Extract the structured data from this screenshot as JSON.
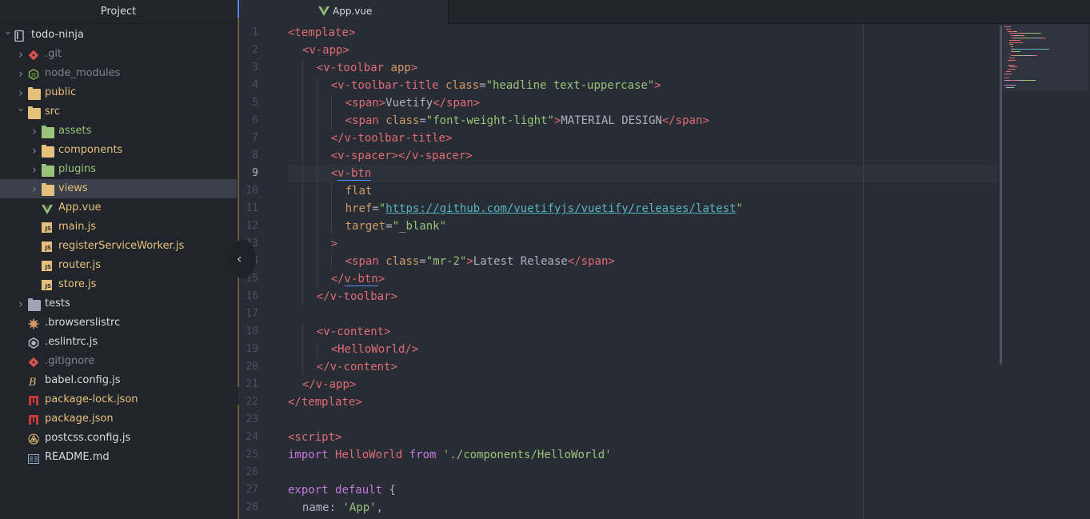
{
  "sidebar": {
    "title": "Project",
    "tree": [
      {
        "label": "todo-ninja",
        "kind": "repo",
        "depth": 0,
        "expanded": true
      },
      {
        "label": ".git",
        "kind": "git",
        "depth": 1,
        "expanded": false
      },
      {
        "label": "node_modules",
        "kind": "node",
        "depth": 1,
        "expanded": false
      },
      {
        "label": "public",
        "kind": "folder",
        "depth": 1,
        "expanded": false
      },
      {
        "label": "src",
        "kind": "folder",
        "depth": 1,
        "expanded": true
      },
      {
        "label": "assets",
        "kind": "folder-green",
        "depth": 2,
        "expanded": false
      },
      {
        "label": "components",
        "kind": "folder",
        "depth": 2,
        "expanded": false
      },
      {
        "label": "plugins",
        "kind": "folder-green",
        "depth": 2,
        "expanded": false
      },
      {
        "label": "views",
        "kind": "folder",
        "depth": 2,
        "expanded": false,
        "selected": true
      },
      {
        "label": "App.vue",
        "kind": "vue",
        "depth": 2
      },
      {
        "label": "main.js",
        "kind": "js",
        "depth": 2
      },
      {
        "label": "registerServiceWorker.js",
        "kind": "js",
        "depth": 2
      },
      {
        "label": "router.js",
        "kind": "js",
        "depth": 2
      },
      {
        "label": "store.js",
        "kind": "js",
        "depth": 2
      },
      {
        "label": "tests",
        "kind": "folder-grey",
        "depth": 1,
        "expanded": false
      },
      {
        "label": ".browserslistrc",
        "kind": "browsers",
        "depth": 1
      },
      {
        "label": ".eslintrc.js",
        "kind": "eslint",
        "depth": 1
      },
      {
        "label": ".gitignore",
        "kind": "git",
        "depth": 1
      },
      {
        "label": "babel.config.js",
        "kind": "babel",
        "depth": 1
      },
      {
        "label": "package-lock.json",
        "kind": "npm",
        "depth": 1
      },
      {
        "label": "package.json",
        "kind": "npm",
        "depth": 1
      },
      {
        "label": "postcss.config.js",
        "kind": "postcss",
        "depth": 1
      },
      {
        "label": "README.md",
        "kind": "readme",
        "depth": 1
      }
    ]
  },
  "tab": {
    "label": "App.vue"
  },
  "editor": {
    "cursor_line": 9,
    "lines": [
      {
        "n": "1",
        "indent": 0,
        "tokens": [
          [
            "tag",
            "<template>"
          ]
        ]
      },
      {
        "n": "2",
        "indent": 1,
        "tokens": [
          [
            "tag",
            "<v-app>"
          ]
        ]
      },
      {
        "n": "3",
        "indent": 2,
        "tokens": [
          [
            "tag",
            "<v-toolbar"
          ],
          [
            "p",
            " "
          ],
          [
            "attr",
            "app"
          ],
          [
            "tag",
            ">"
          ]
        ]
      },
      {
        "n": "4",
        "indent": 3,
        "tokens": [
          [
            "tag",
            "<v-toolbar-title"
          ],
          [
            "p",
            " "
          ],
          [
            "attr",
            "class"
          ],
          [
            "p",
            "="
          ],
          [
            "str",
            "\"headline text-uppercase\""
          ],
          [
            "tag",
            ">"
          ]
        ]
      },
      {
        "n": "5",
        "indent": 4,
        "tokens": [
          [
            "tag",
            "<span>"
          ],
          [
            "p",
            "Vuetify"
          ],
          [
            "tag",
            "</span>"
          ]
        ]
      },
      {
        "n": "6",
        "indent": 4,
        "tokens": [
          [
            "tag",
            "<span"
          ],
          [
            "p",
            " "
          ],
          [
            "attr",
            "class"
          ],
          [
            "p",
            "="
          ],
          [
            "str",
            "\"font-weight-light\""
          ],
          [
            "tag",
            ">"
          ],
          [
            "p",
            "MATERIAL DESIGN"
          ],
          [
            "tag",
            "</span>"
          ]
        ]
      },
      {
        "n": "7",
        "indent": 3,
        "tokens": [
          [
            "tag",
            "</v-toolbar-title>"
          ]
        ]
      },
      {
        "n": "8",
        "indent": 3,
        "tokens": [
          [
            "tag",
            "<v-spacer></v-spacer>"
          ]
        ]
      },
      {
        "n": "9",
        "indent": 3,
        "tokens": [
          [
            "tag",
            "<"
          ],
          [
            "taghl",
            "v-btn"
          ]
        ]
      },
      {
        "n": "10",
        "indent": 4,
        "tokens": [
          [
            "attr",
            "flat"
          ]
        ]
      },
      {
        "n": "11",
        "indent": 4,
        "tokens": [
          [
            "attr",
            "href"
          ],
          [
            "p",
            "="
          ],
          [
            "str",
            "\""
          ],
          [
            "url",
            "https://github.com/vuetifyjs/vuetify/releases/latest"
          ],
          [
            "str",
            "\""
          ]
        ]
      },
      {
        "n": "12",
        "indent": 4,
        "tokens": [
          [
            "attr",
            "target"
          ],
          [
            "p",
            "="
          ],
          [
            "str",
            "\"_blank\""
          ]
        ]
      },
      {
        "n": "13",
        "indent": 3,
        "tokens": [
          [
            "tag",
            ">"
          ]
        ]
      },
      {
        "n": "14",
        "indent": 4,
        "tokens": [
          [
            "tag",
            "<span"
          ],
          [
            "p",
            " "
          ],
          [
            "attr",
            "class"
          ],
          [
            "p",
            "="
          ],
          [
            "str",
            "\"mr-2\""
          ],
          [
            "tag",
            ">"
          ],
          [
            "p",
            "Latest Release"
          ],
          [
            "tag",
            "</span>"
          ]
        ]
      },
      {
        "n": "15",
        "indent": 3,
        "tokens": [
          [
            "tag",
            "</"
          ],
          [
            "taghl",
            "v-btn"
          ],
          [
            "tag",
            ">"
          ]
        ]
      },
      {
        "n": "16",
        "indent": 2,
        "tokens": [
          [
            "tag",
            "</v-toolbar>"
          ]
        ]
      },
      {
        "n": "17",
        "indent": 0,
        "tokens": []
      },
      {
        "n": "18",
        "indent": 2,
        "tokens": [
          [
            "tag",
            "<v-content>"
          ]
        ]
      },
      {
        "n": "19",
        "indent": 3,
        "tokens": [
          [
            "tag",
            "<HelloWorld/>"
          ]
        ]
      },
      {
        "n": "20",
        "indent": 2,
        "tokens": [
          [
            "tag",
            "</v-content>"
          ]
        ]
      },
      {
        "n": "21",
        "indent": 1,
        "tokens": [
          [
            "tag",
            "</v-app>"
          ]
        ]
      },
      {
        "n": "22",
        "indent": 0,
        "tokens": [
          [
            "tag",
            "</template>"
          ]
        ]
      },
      {
        "n": "23",
        "indent": 0,
        "tokens": []
      },
      {
        "n": "24",
        "indent": 0,
        "tokens": [
          [
            "tag",
            "<script>"
          ]
        ]
      },
      {
        "n": "25",
        "indent": 0,
        "tokens": [
          [
            "kw",
            "import"
          ],
          [
            "p",
            " "
          ],
          [
            "tag",
            "HelloWorld"
          ],
          [
            "p",
            " "
          ],
          [
            "kw",
            "from"
          ],
          [
            "p",
            " "
          ],
          [
            "str",
            "'./components/HelloWorld'"
          ]
        ]
      },
      {
        "n": "26",
        "indent": 0,
        "tokens": []
      },
      {
        "n": "27",
        "indent": 0,
        "tokens": [
          [
            "kw",
            "export"
          ],
          [
            "p",
            " "
          ],
          [
            "kw",
            "default"
          ],
          [
            "p",
            " {"
          ]
        ]
      },
      {
        "n": "28",
        "indent": 1,
        "tokens": [
          [
            "p",
            "name: "
          ],
          [
            "str",
            "'App'"
          ],
          [
            "p",
            ","
          ]
        ]
      }
    ]
  },
  "colors": {
    "tag": "#e06c75",
    "attr": "#d19a66",
    "string": "#98c379",
    "keyword": "#c678dd",
    "url": "#56b6c2",
    "plain": "#abb2bf",
    "accent": "#528bff",
    "sidebar_bg": "#21252b",
    "editor_bg": "#282c34"
  }
}
